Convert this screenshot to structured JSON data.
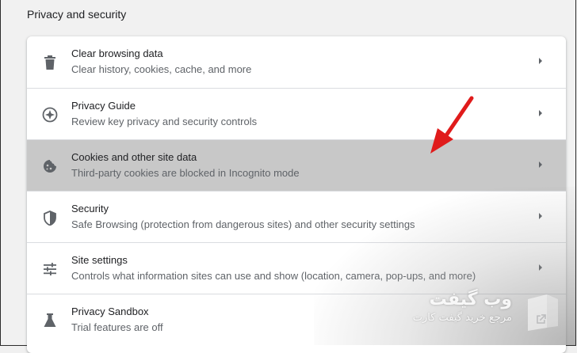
{
  "section": {
    "title": "Privacy and security"
  },
  "rows": [
    {
      "icon": "trash-icon",
      "title": "Clear browsing data",
      "subtitle": "Clear history, cookies, cache, and more"
    },
    {
      "icon": "compass-icon",
      "title": "Privacy Guide",
      "subtitle": "Review key privacy and security controls"
    },
    {
      "icon": "cookie-icon",
      "title": "Cookies and other site data",
      "subtitle": "Third-party cookies are blocked in Incognito mode",
      "highlighted": true
    },
    {
      "icon": "shield-icon",
      "title": "Security",
      "subtitle": "Safe Browsing (protection from dangerous sites) and other security settings"
    },
    {
      "icon": "sliders-icon",
      "title": "Site settings",
      "subtitle": "Controls what information sites can use and show (location, camera, pop-ups, and more)"
    },
    {
      "icon": "flask-icon",
      "title": "Privacy Sandbox",
      "subtitle": "Trial features are off"
    }
  ],
  "watermark": {
    "logo": "وب گیفت",
    "tagline": "مرجع خرید گیفت کارت"
  },
  "colors": {
    "highlight_row": "#c8c8c8",
    "arrow": "#e01b1b",
    "icon": "#5f6368"
  }
}
